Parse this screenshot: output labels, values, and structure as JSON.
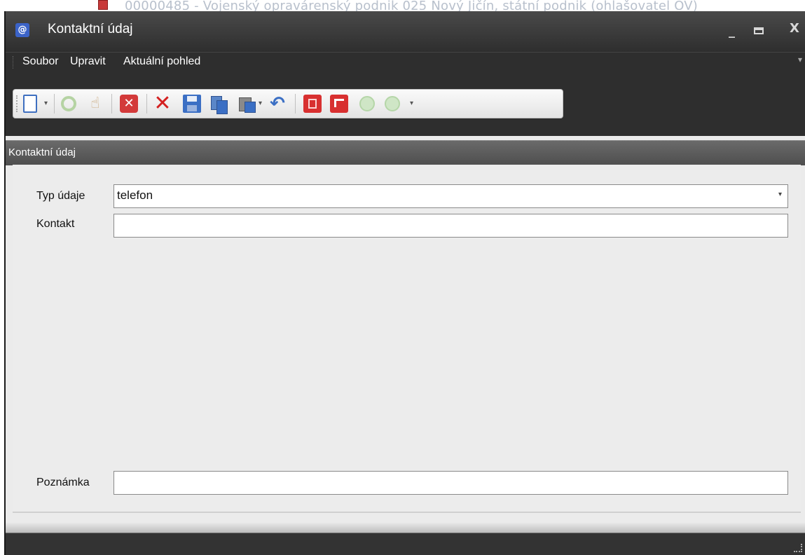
{
  "background_window": {
    "title": "00000485 - Vojenský opravárenský podnik 025 Nový Jičín, státní podnik (ohlašovatel OV)"
  },
  "window": {
    "title": "Kontaktní údaj",
    "icon": "contact-icon",
    "controls": {
      "minimize": "_",
      "close": "X"
    }
  },
  "menu": {
    "items": [
      {
        "label": "Soubor"
      },
      {
        "label": "Upravit"
      },
      {
        "label": "Aktuální pohled"
      }
    ],
    "overflow_glyph": "▾"
  },
  "toolbar": {
    "buttons": [
      {
        "icon": "new-document-icon"
      },
      {
        "icon": "refresh-icon"
      },
      {
        "icon": "hand-icon"
      },
      {
        "icon": "cancel-icon",
        "glyph": "✕"
      },
      {
        "icon": "delete-icon",
        "glyph": "✕"
      },
      {
        "icon": "save-icon"
      },
      {
        "icon": "copy-icon"
      },
      {
        "icon": "paste-icon"
      },
      {
        "icon": "undo-icon",
        "glyph": "↶"
      },
      {
        "icon": "report-icon"
      },
      {
        "icon": "export-icon"
      },
      {
        "icon": "add-circle-icon"
      },
      {
        "icon": "down-circle-icon"
      }
    ],
    "dropdown_glyph": "▾"
  },
  "panel": {
    "title": "Kontaktní údaj"
  },
  "form": {
    "type": {
      "label": "Typ údaje",
      "value": "telefon"
    },
    "contact": {
      "label": "Kontakt",
      "value": ""
    },
    "note": {
      "label": "Poznámka",
      "value": ""
    }
  },
  "colors": {
    "titlebar": "#2e2e2e",
    "panel_header": "#5a5a5a",
    "form_bg": "#ececec",
    "accent_red": "#d83030",
    "accent_blue": "#3b6fc4"
  }
}
